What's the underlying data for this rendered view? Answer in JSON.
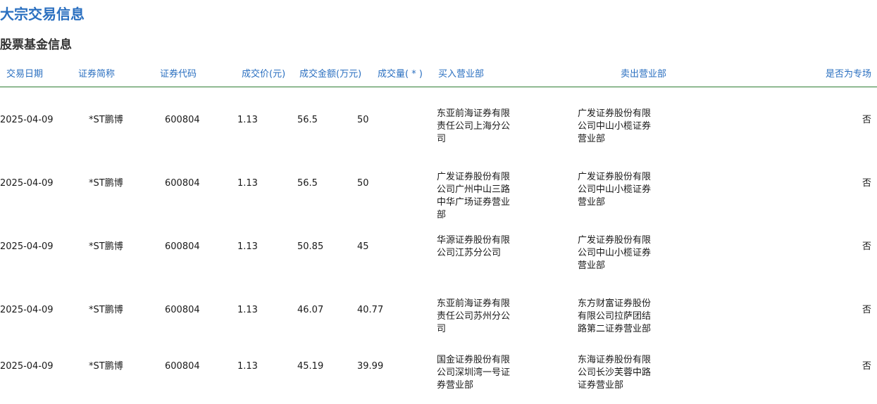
{
  "page_title": "大宗交易信息",
  "section_title": "股票基金信息",
  "columns": {
    "date": "交易日期",
    "name": "证券简称",
    "code": "证券代码",
    "price": "成交价(元)",
    "amount": "成交金额(万元)",
    "volume": "成交量( * )",
    "buy": "买入营业部",
    "sell": "卖出营业部",
    "special": "是否为专场"
  },
  "rows": [
    {
      "date": "2025-04-09",
      "name": "*ST鹏博",
      "code": "600804",
      "price": "1.13",
      "amount": "56.5",
      "volume": "50",
      "buy": "东亚前海证券有限责任公司上海分公司",
      "sell": "广发证券股份有限公司中山小榄证券营业部",
      "special": "否"
    },
    {
      "date": "2025-04-09",
      "name": "*ST鹏博",
      "code": "600804",
      "price": "1.13",
      "amount": "56.5",
      "volume": "50",
      "buy": "广发证券股份有限公司广州中山三路中华广场证券营业部",
      "sell": "广发证券股份有限公司中山小榄证券营业部",
      "special": "否"
    },
    {
      "date": "2025-04-09",
      "name": "*ST鹏博",
      "code": "600804",
      "price": "1.13",
      "amount": "50.85",
      "volume": "45",
      "buy": "华源证券股份有限公司江苏分公司",
      "sell": "广发证券股份有限公司中山小榄证券营业部",
      "special": "否"
    },
    {
      "date": "2025-04-09",
      "name": "*ST鹏博",
      "code": "600804",
      "price": "1.13",
      "amount": "46.07",
      "volume": "40.77",
      "buy": "东亚前海证券有限责任公司苏州分公司",
      "sell": "东方财富证券股份有限公司拉萨团结路第二证券营业部",
      "special": "否"
    },
    {
      "date": "2025-04-09",
      "name": "*ST鹏博",
      "code": "600804",
      "price": "1.13",
      "amount": "45.19",
      "volume": "39.99",
      "buy": "国金证券股份有限公司深圳湾一号证券营业部",
      "sell": "东海证券股份有限公司长沙芙蓉中路证券营业部",
      "special": "否"
    }
  ]
}
